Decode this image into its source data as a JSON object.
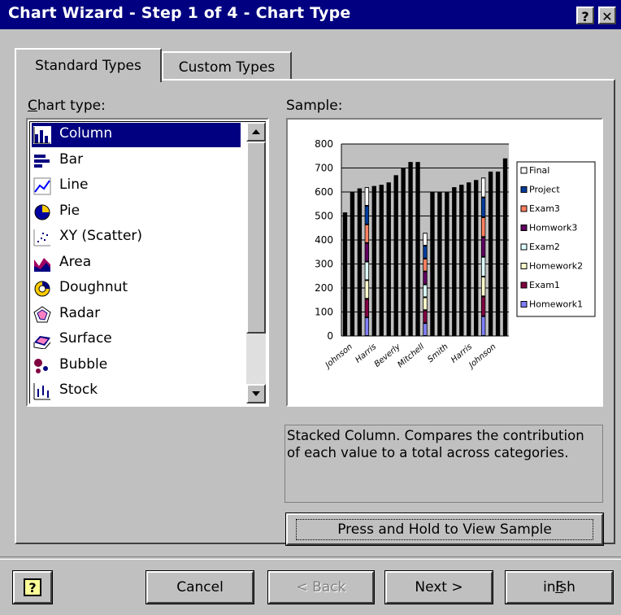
{
  "window": {
    "title": "Chart Wizard - Step 1 of 4 - Chart Type",
    "help_btn": "?",
    "close_btn": "✕"
  },
  "tabs": [
    {
      "label": "Standard Types",
      "active": true
    },
    {
      "label": "Custom Types",
      "active": false
    }
  ],
  "chart_type_label": "Chart type:",
  "chart_types": [
    {
      "label": "Column",
      "icon": "column-chart-icon",
      "selected": true
    },
    {
      "label": "Bar",
      "icon": "bar-chart-icon"
    },
    {
      "label": "Line",
      "icon": "line-chart-icon"
    },
    {
      "label": "Pie",
      "icon": "pie-chart-icon"
    },
    {
      "label": "XY (Scatter)",
      "icon": "scatter-chart-icon"
    },
    {
      "label": "Area",
      "icon": "area-chart-icon"
    },
    {
      "label": "Doughnut",
      "icon": "doughnut-chart-icon"
    },
    {
      "label": "Radar",
      "icon": "radar-chart-icon"
    },
    {
      "label": "Surface",
      "icon": "surface-chart-icon"
    },
    {
      "label": "Bubble",
      "icon": "bubble-chart-icon"
    },
    {
      "label": "Stock",
      "icon": "stock-chart-icon"
    }
  ],
  "sample_label": "Sample:",
  "description": "Stacked Column. Compares the contribution of each value to a total across categories.",
  "press_hold_label": "Press and Hold to View Sample",
  "buttons": {
    "cancel": "Cancel",
    "back": "< Back",
    "next": "Next >",
    "finish": "Finish"
  },
  "colors": {
    "titlebar": "#000080",
    "face": "#c0c0c0",
    "selection": "#000080"
  },
  "chart_data": {
    "type": "bar",
    "stacked": true,
    "categories": [
      "Johnson",
      "Harris",
      "Beverly",
      "Mitchell",
      "Smith",
      "Harris",
      "Johnson"
    ],
    "ylim": [
      0,
      800
    ],
    "yticks": [
      0,
      100,
      200,
      300,
      400,
      500,
      600,
      700,
      800
    ],
    "column_totals": [
      515,
      600,
      615,
      620,
      625,
      630,
      640,
      670,
      700,
      725,
      725,
      430,
      600,
      600,
      600,
      620,
      630,
      640,
      650,
      660,
      685,
      685,
      740
    ],
    "legend": [
      "Final",
      "Project",
      "Exam3",
      "Homwork3",
      "Exam2",
      "Homework2",
      "Exam1",
      "Homework1"
    ],
    "legend_colors": [
      "#ffffff",
      "#003c9c",
      "#ff8060",
      "#600060",
      "#ddffff",
      "#ffffcc",
      "#800040",
      "#8080ff"
    ],
    "grid": "horizontal",
    "legend_position": "right"
  }
}
